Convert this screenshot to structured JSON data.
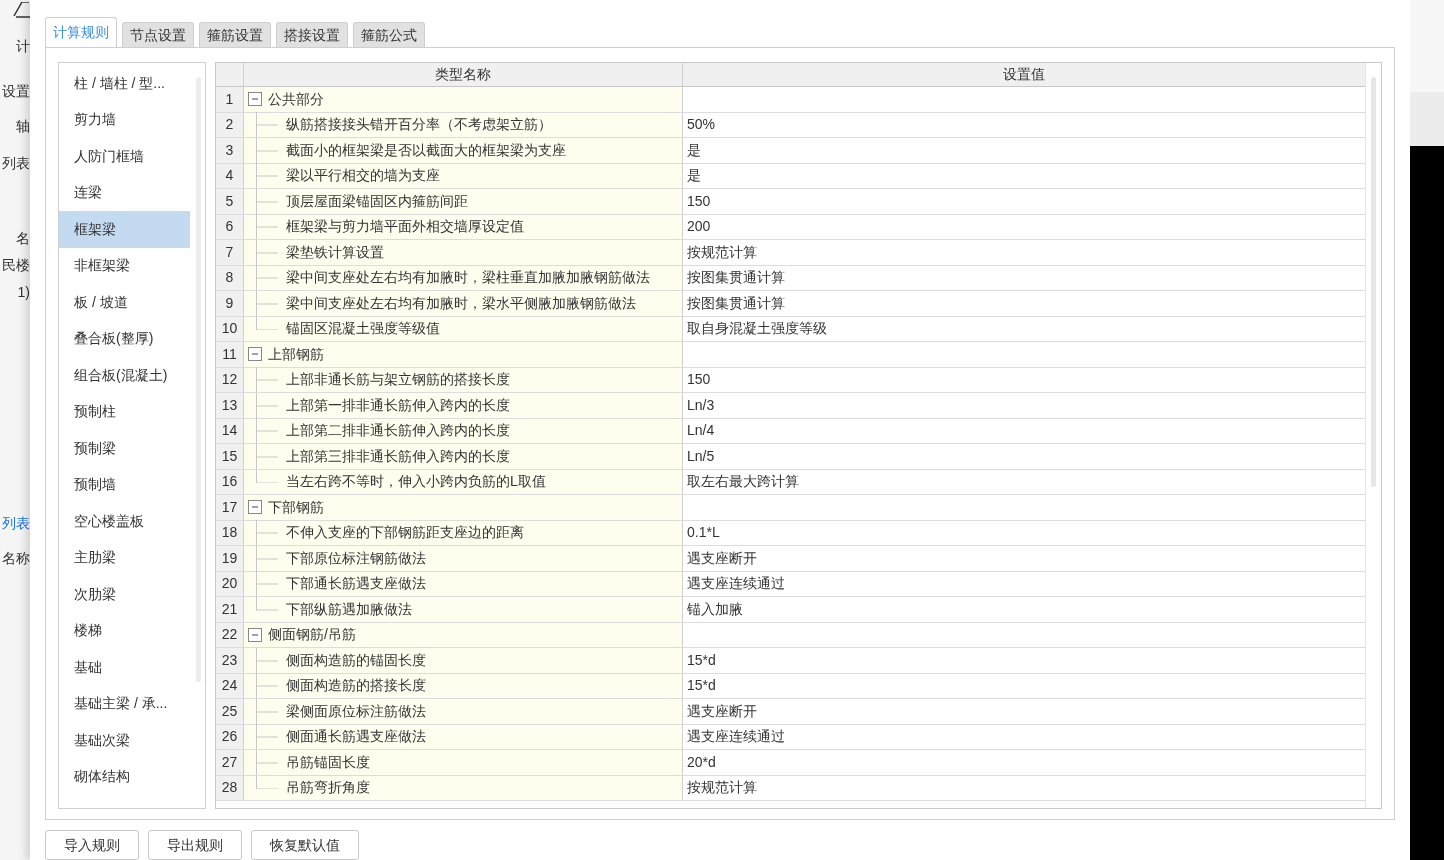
{
  "background_app": {
    "labels": [
      "计",
      "设置",
      "轴",
      "列表",
      "名",
      "民楼",
      "1)",
      "列表",
      "名称"
    ]
  },
  "tabs": [
    {
      "label": "计算规则",
      "selected": true
    },
    {
      "label": "节点设置",
      "selected": false
    },
    {
      "label": "箍筋设置",
      "selected": false
    },
    {
      "label": "搭接设置",
      "selected": false
    },
    {
      "label": "箍筋公式",
      "selected": false
    }
  ],
  "categories": [
    {
      "label": "柱 / 墙柱 / 型...",
      "selected": false
    },
    {
      "label": "剪力墙",
      "selected": false
    },
    {
      "label": "人防门框墙",
      "selected": false
    },
    {
      "label": "连梁",
      "selected": false
    },
    {
      "label": "框架梁",
      "selected": true
    },
    {
      "label": "非框架梁",
      "selected": false
    },
    {
      "label": "板 / 坡道",
      "selected": false
    },
    {
      "label": "叠合板(整厚)",
      "selected": false
    },
    {
      "label": "组合板(混凝土)",
      "selected": false
    },
    {
      "label": "预制柱",
      "selected": false
    },
    {
      "label": "预制梁",
      "selected": false
    },
    {
      "label": "预制墙",
      "selected": false
    },
    {
      "label": "空心楼盖板",
      "selected": false
    },
    {
      "label": "主肋梁",
      "selected": false
    },
    {
      "label": "次肋梁",
      "selected": false
    },
    {
      "label": "楼梯",
      "selected": false
    },
    {
      "label": "基础",
      "selected": false
    },
    {
      "label": "基础主梁 / 承...",
      "selected": false
    },
    {
      "label": "基础次梁",
      "selected": false
    },
    {
      "label": "砌体结构",
      "selected": false
    }
  ],
  "table": {
    "columns": [
      "类型名称",
      "设置值"
    ],
    "rows": [
      {
        "number": "1",
        "name": "公共部分",
        "expanded": true,
        "children": [
          {
            "number": "2",
            "name": "纵筋搭接接头错开百分率（不考虑架立筋）",
            "value": "50%"
          },
          {
            "number": "3",
            "name": "截面小的框架梁是否以截面大的框架梁为支座",
            "value": "是"
          },
          {
            "number": "4",
            "name": "梁以平行相交的墙为支座",
            "value": "是"
          },
          {
            "number": "5",
            "name": "顶层屋面梁锚固区内箍筋间距",
            "value": "150"
          },
          {
            "number": "6",
            "name": "框架梁与剪力墙平面外相交墙厚设定值",
            "value": "200"
          },
          {
            "number": "7",
            "name": "梁垫铁计算设置",
            "value": "按规范计算"
          },
          {
            "number": "8",
            "name": "梁中间支座处左右均有加腋时，梁柱垂直加腋加腋钢筋做法",
            "value": "按图集贯通计算"
          },
          {
            "number": "9",
            "name": "梁中间支座处左右均有加腋时，梁水平侧腋加腋钢筋做法",
            "value": "按图集贯通计算"
          },
          {
            "number": "10",
            "name": "锚固区混凝土强度等级值",
            "value": "取自身混凝土强度等级"
          }
        ]
      },
      {
        "number": "11",
        "name": "上部钢筋",
        "expanded": true,
        "children": [
          {
            "number": "12",
            "name": "上部非通长筋与架立钢筋的搭接长度",
            "value": "150"
          },
          {
            "number": "13",
            "name": "上部第一排非通长筋伸入跨内的长度",
            "value": "Ln/3"
          },
          {
            "number": "14",
            "name": "上部第二排非通长筋伸入跨内的长度",
            "value": "Ln/4"
          },
          {
            "number": "15",
            "name": "上部第三排非通长筋伸入跨内的长度",
            "value": "Ln/5"
          },
          {
            "number": "16",
            "name": "当左右跨不等时，伸入小跨内负筋的L取值",
            "value": "取左右最大跨计算"
          }
        ]
      },
      {
        "number": "17",
        "name": "下部钢筋",
        "expanded": true,
        "children": [
          {
            "number": "18",
            "name": "不伸入支座的下部钢筋距支座边的距离",
            "value": "0.1*L"
          },
          {
            "number": "19",
            "name": "下部原位标注钢筋做法",
            "value": "遇支座断开"
          },
          {
            "number": "20",
            "name": "下部通长筋遇支座做法",
            "value": "遇支座连续通过"
          },
          {
            "number": "21",
            "name": "下部纵筋遇加腋做法",
            "value": "锚入加腋"
          }
        ]
      },
      {
        "number": "22",
        "name": "侧面钢筋/吊筋",
        "expanded": true,
        "children": [
          {
            "number": "23",
            "name": "侧面构造筋的锚固长度",
            "value": "15*d"
          },
          {
            "number": "24",
            "name": "侧面构造筋的搭接长度",
            "value": "15*d"
          },
          {
            "number": "25",
            "name": "梁侧面原位标注筋做法",
            "value": "遇支座断开"
          },
          {
            "number": "26",
            "name": "侧面通长筋遇支座做法",
            "value": "遇支座连续通过"
          },
          {
            "number": "27",
            "name": "吊筋锚固长度",
            "value": "20*d"
          },
          {
            "number": "28",
            "name": "吊筋弯折角度",
            "value": "按规范计算"
          }
        ]
      }
    ]
  },
  "buttons": [
    "导入规则",
    "导出规则",
    "恢复默认值"
  ]
}
